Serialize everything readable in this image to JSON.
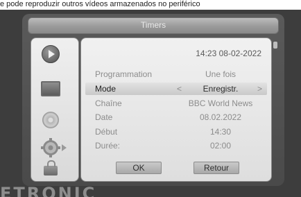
{
  "caption": "e pode reproduzir outros vídeos armazenados no periférico",
  "window": {
    "title": "Timers"
  },
  "sidebar": {
    "icons": [
      "play-icon",
      "tv-screen-icon",
      "disc-icon",
      "gear-settings-icon",
      "lock-icon"
    ],
    "selected": "gear-settings-icon"
  },
  "panel": {
    "datetime": "14:23 08-02-2022",
    "rows": [
      {
        "label": "Programmation",
        "value": "Une fois"
      },
      {
        "label": "Mode",
        "value": "Enregistr.",
        "selected": true
      },
      {
        "label": "Chaîne",
        "value": "BBC World News"
      },
      {
        "label": "Date",
        "value": "08.02.2022"
      },
      {
        "label": "Début",
        "value": "14:30"
      },
      {
        "label": "Durée:",
        "value": "02:00"
      }
    ],
    "buttons": {
      "ok": "OK",
      "back": "Retour"
    }
  },
  "brand": "ETRONIC",
  "colors": {
    "frame": "#4a4a4a",
    "panel": "#e6e6e6",
    "selected_row": "#cfcfcf"
  }
}
